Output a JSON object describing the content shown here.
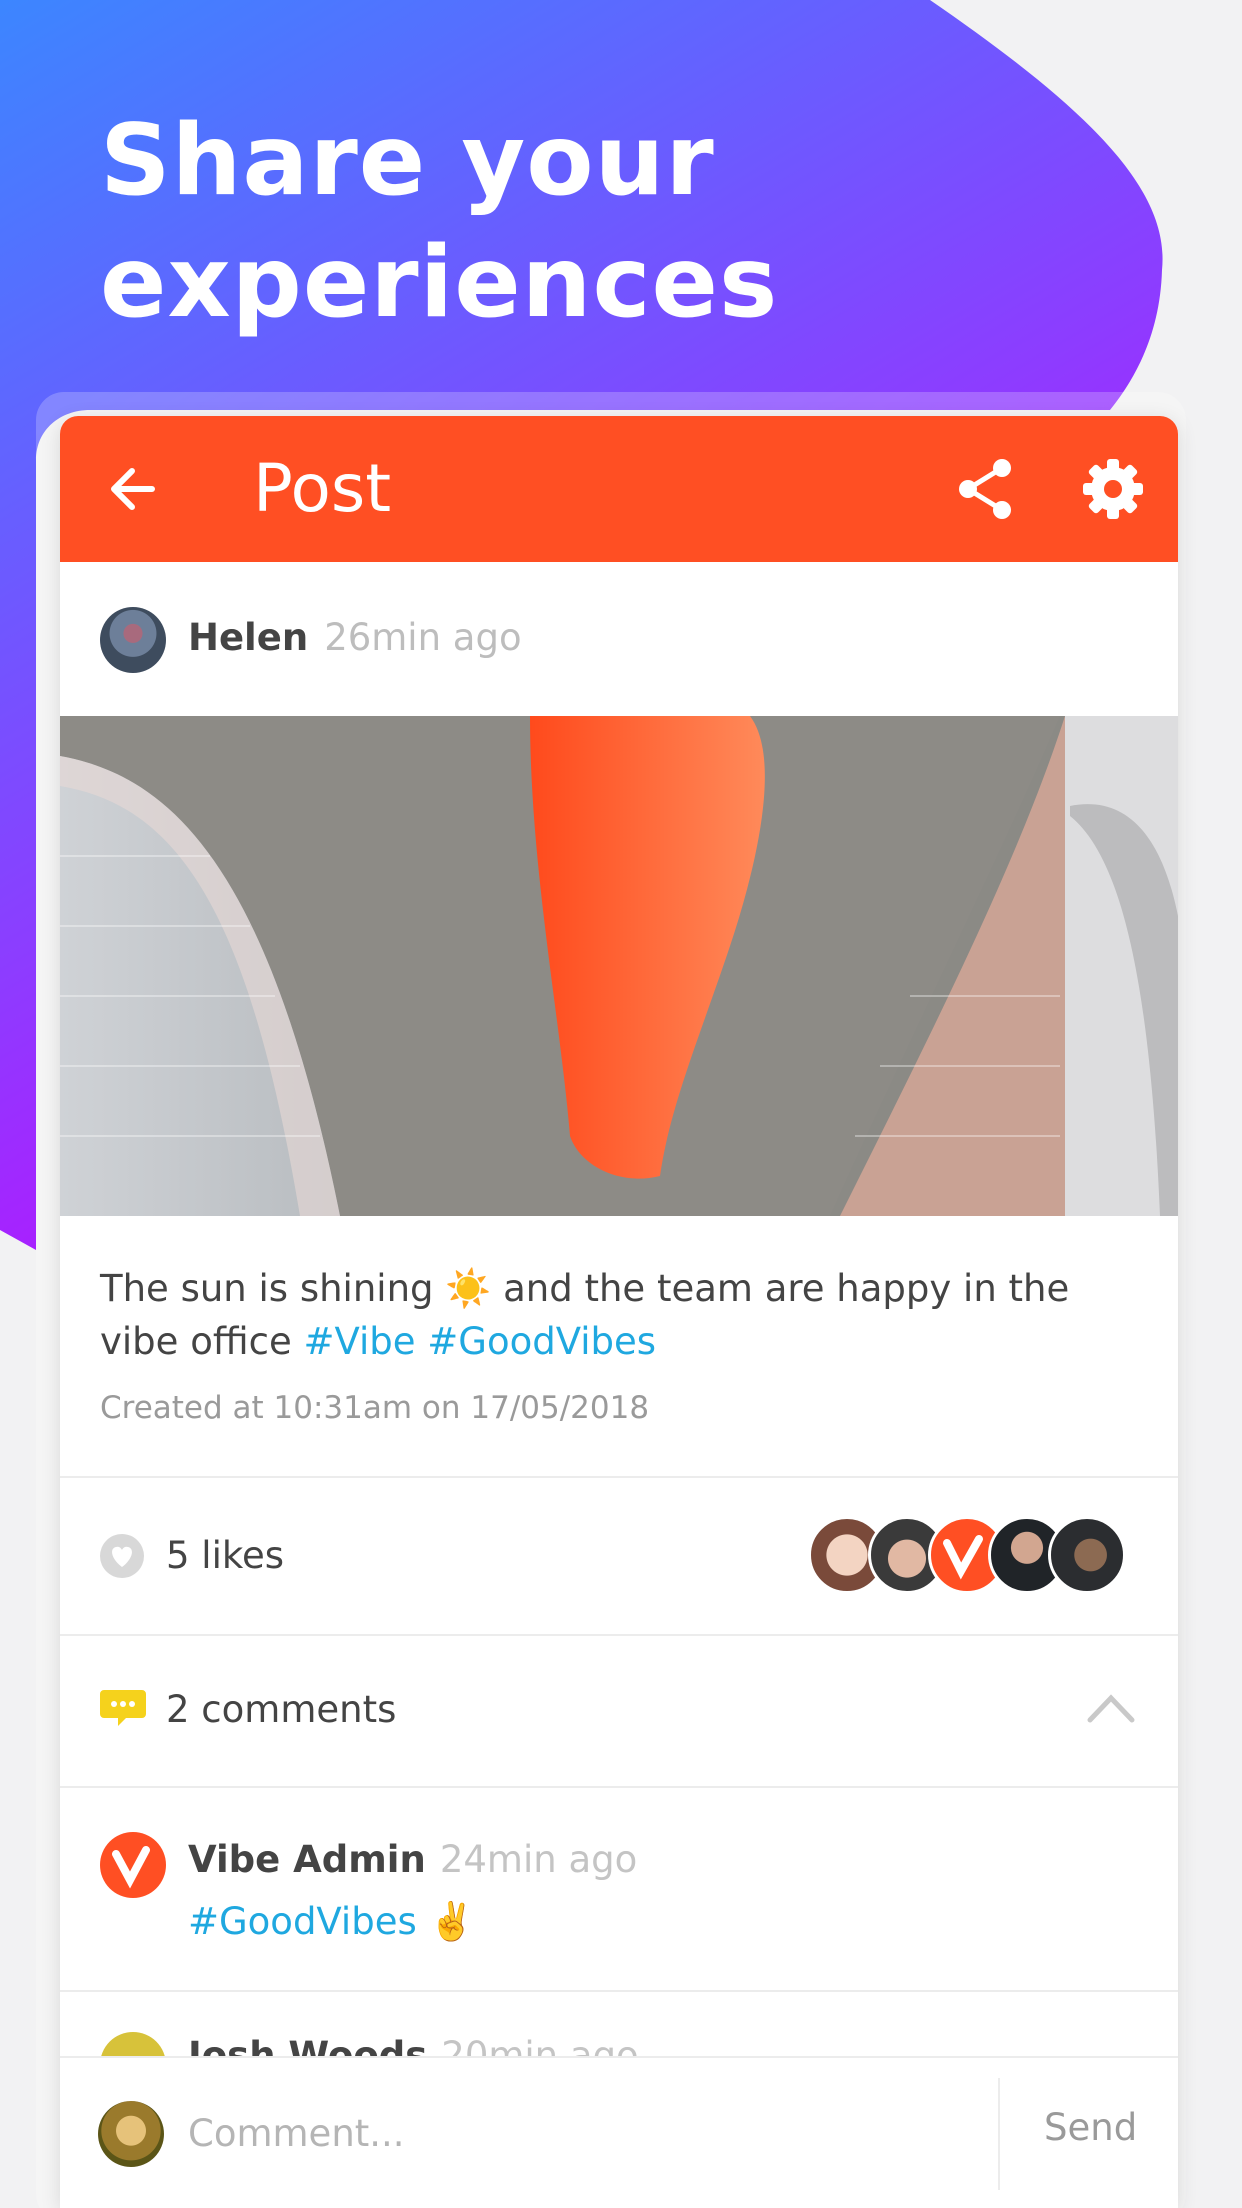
{
  "hero": {
    "line1": "Share your",
    "line2": "experiences"
  },
  "appbar": {
    "title": "Post"
  },
  "post": {
    "author": "Helen",
    "time": "26min ago",
    "caption_text": "The sun is shining ☀️ and the team are happy in the vibe office",
    "hashtags": [
      "#Vibe",
      "#GoodVibes"
    ],
    "created": "Created at 10:31am on 17/05/2018"
  },
  "likes": {
    "label": "5 likes"
  },
  "comments": {
    "label": "2 comments",
    "items": [
      {
        "author": "Vibe Admin",
        "time": "24min ago",
        "text": "#GoodVibes ✌️"
      },
      {
        "author": "Josh Woods",
        "time": "20min ago",
        "text": ""
      }
    ]
  },
  "composer": {
    "placeholder": "Comment...",
    "send_label": "Send"
  },
  "colors": {
    "brand_orange": "#ff4f23",
    "hashtag_blue": "#1fa8e0",
    "gradient_start": "#3c86ff",
    "gradient_end": "#c800ff"
  },
  "icons": [
    "arrow-left-icon",
    "share-icon",
    "gear-icon",
    "heart-icon",
    "comment-bubble-icon",
    "chevron-up-icon",
    "vibe-logo-icon"
  ]
}
